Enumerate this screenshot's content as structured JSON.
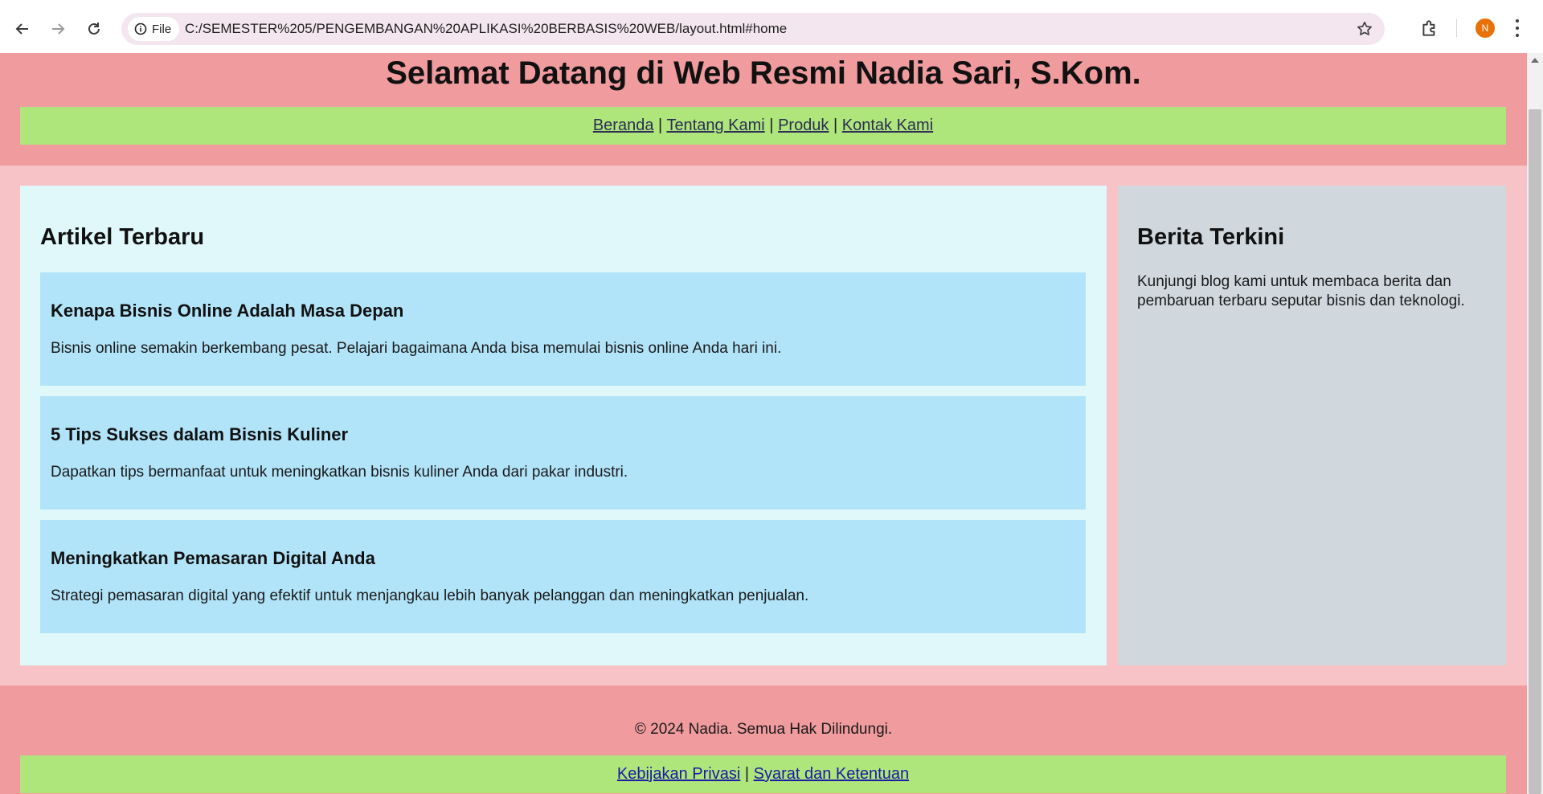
{
  "browser": {
    "scheme_label": "File",
    "url": "C:/SEMESTER%205/PENGEMBANGAN%20APLIKASI%20BERBASIS%20WEB/layout.html#home",
    "avatar_initial": "N",
    "avatar_color": "#e8710a"
  },
  "header": {
    "title": "Selamat Datang di Web Resmi Nadia Sari, S.Kom.",
    "nav": [
      {
        "label": "Beranda"
      },
      {
        "label": "Tentang Kami"
      },
      {
        "label": "Produk"
      },
      {
        "label": "Kontak Kami"
      }
    ],
    "separator": "|"
  },
  "main": {
    "title": "Artikel Terbaru",
    "articles": [
      {
        "title": "Kenapa Bisnis Online Adalah Masa Depan",
        "text": "Bisnis online semakin berkembang pesat. Pelajari bagaimana Anda bisa memulai bisnis online Anda hari ini."
      },
      {
        "title": "5 Tips Sukses dalam Bisnis Kuliner",
        "text": "Dapatkan tips bermanfaat untuk meningkatkan bisnis kuliner Anda dari pakar industri."
      },
      {
        "title": "Meningkatkan Pemasaran Digital Anda",
        "text": "Strategi pemasaran digital yang efektif untuk menjangkau lebih banyak pelanggan dan meningkatkan penjualan."
      }
    ]
  },
  "sidebar": {
    "title": "Berita Terkini",
    "text": "Kunjungi blog kami untuk membaca berita dan pembaruan terbaru seputar bisnis dan teknologi."
  },
  "footer": {
    "copyright": "© 2024 Nadia. Semua Hak Dilindungi.",
    "links": [
      {
        "label": "Kebijakan Privasi"
      },
      {
        "label": "Syarat dan Ketentuan"
      }
    ],
    "separator": "|"
  },
  "colors": {
    "header_bg": "#f09b9e",
    "page_bg": "#f7c3c6",
    "nav_bg": "#afe67c",
    "main_bg": "#e0f8fa",
    "article_bg": "#b2e4f9",
    "sidebar_bg": "#d0d8de"
  }
}
